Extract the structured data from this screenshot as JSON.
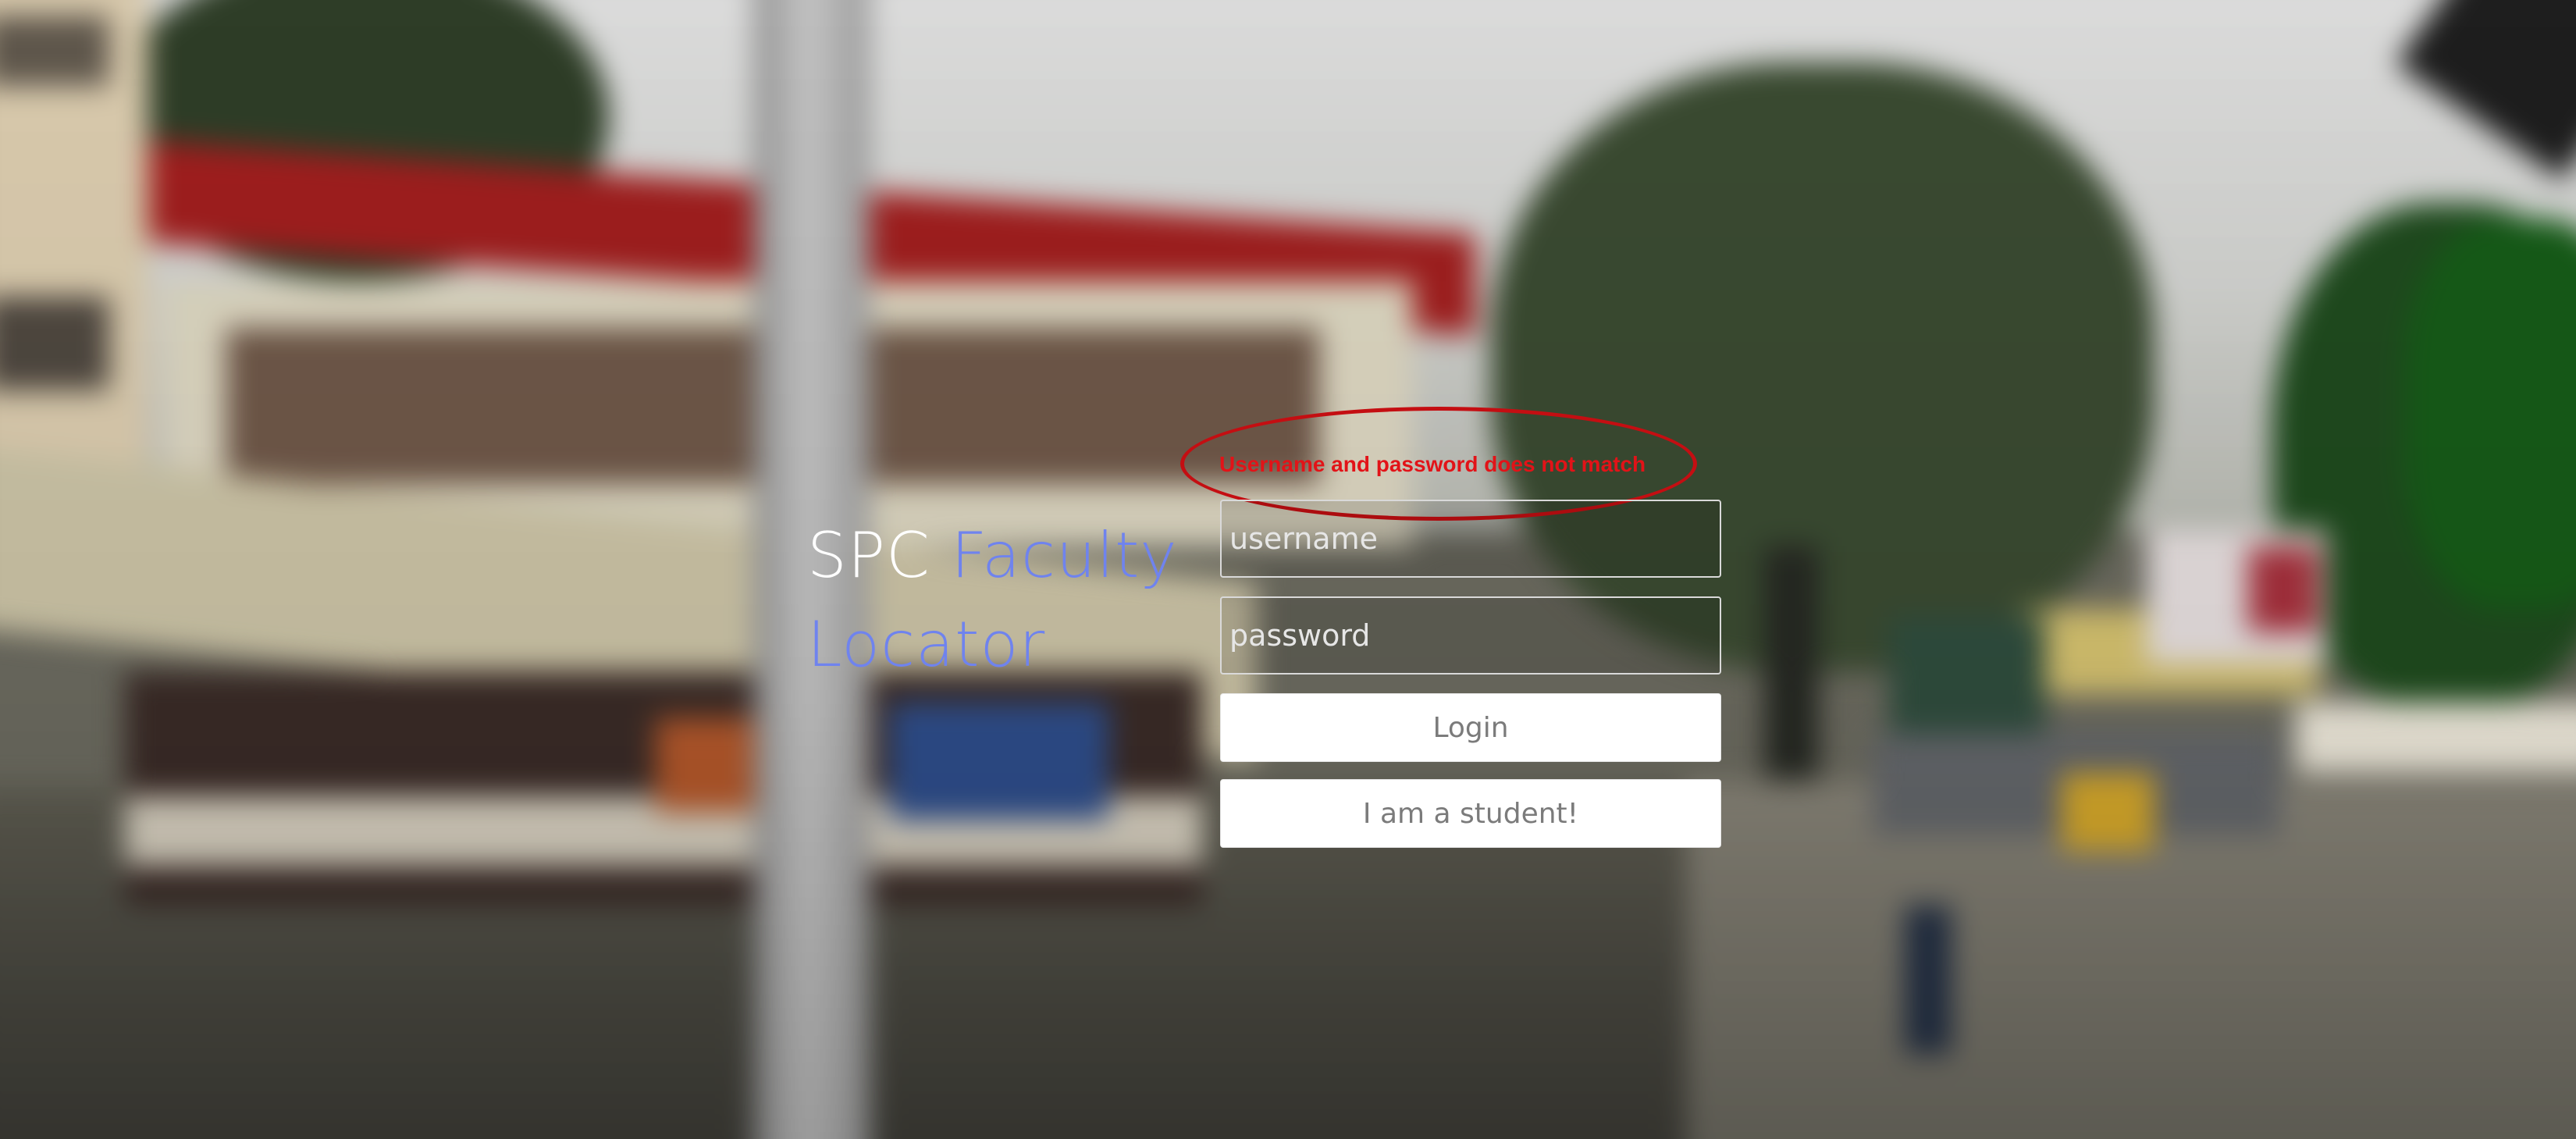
{
  "brand": {
    "title_part1": "SPC",
    "title_part2": "Faculty",
    "title_part3": "Locator",
    "color_primary_word": "#ffffff",
    "color_accent_words": "#6f83ee"
  },
  "alert": {
    "message": "Username and password does not match",
    "color": "#e21318"
  },
  "login": {
    "username_placeholder": "username",
    "username_value": "",
    "password_placeholder": "password",
    "password_value": "",
    "login_button": "Login",
    "student_button": "I am a student!"
  },
  "background": {
    "description_icon": "blurred-campus-photo"
  }
}
